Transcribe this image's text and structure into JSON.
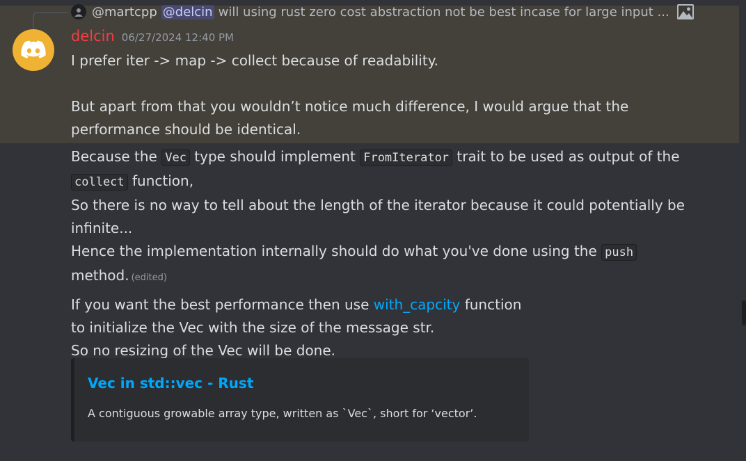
{
  "reply": {
    "author": "@martcpp",
    "mention": "@delcin",
    "text": "will using rust zero cost abstraction not be best incase for large input ...",
    "attachment_icon": "image-icon"
  },
  "message": {
    "author": "delcin",
    "timestamp": "06/27/2024 12:40 PM",
    "avatar_icon": "discord-logo-icon",
    "avatar_color": "#f0b232",
    "username_color": "#f23f43",
    "highlight_color": "#44403a",
    "para1": "I prefer iter -> map -> collect because of readability.",
    "para2": "But apart from that you wouldn’t notice much difference, I would argue that the performance should be identical.",
    "para3": {
      "t1": "Because the ",
      "c1": "Vec",
      "t2": " type should implement ",
      "c2": "FromIterator",
      "t3": " trait to be used as output of the ",
      "c3": "collect",
      "t4": " function,",
      "l2": "So there is no way to tell about the length of the iterator because it could potentially be infinite...",
      "l3a": "Hence the implementation internally should do what you've done using the ",
      "c4": "push",
      "l3b": " method.",
      "edited": "(edited)"
    },
    "para4": {
      "t1": "If you want the best performance then use ",
      "link": "with_capcity",
      "t2": " function",
      "l2": "to initialize the Vec with the size of the message str.",
      "l3": "So no resizing of the Vec will be done."
    }
  },
  "embed": {
    "title": "Vec in std::vec - Rust",
    "description": "A contiguous growable array type, written as `Vec`, short for ‘vector’.",
    "title_color": "#00a8fc"
  }
}
